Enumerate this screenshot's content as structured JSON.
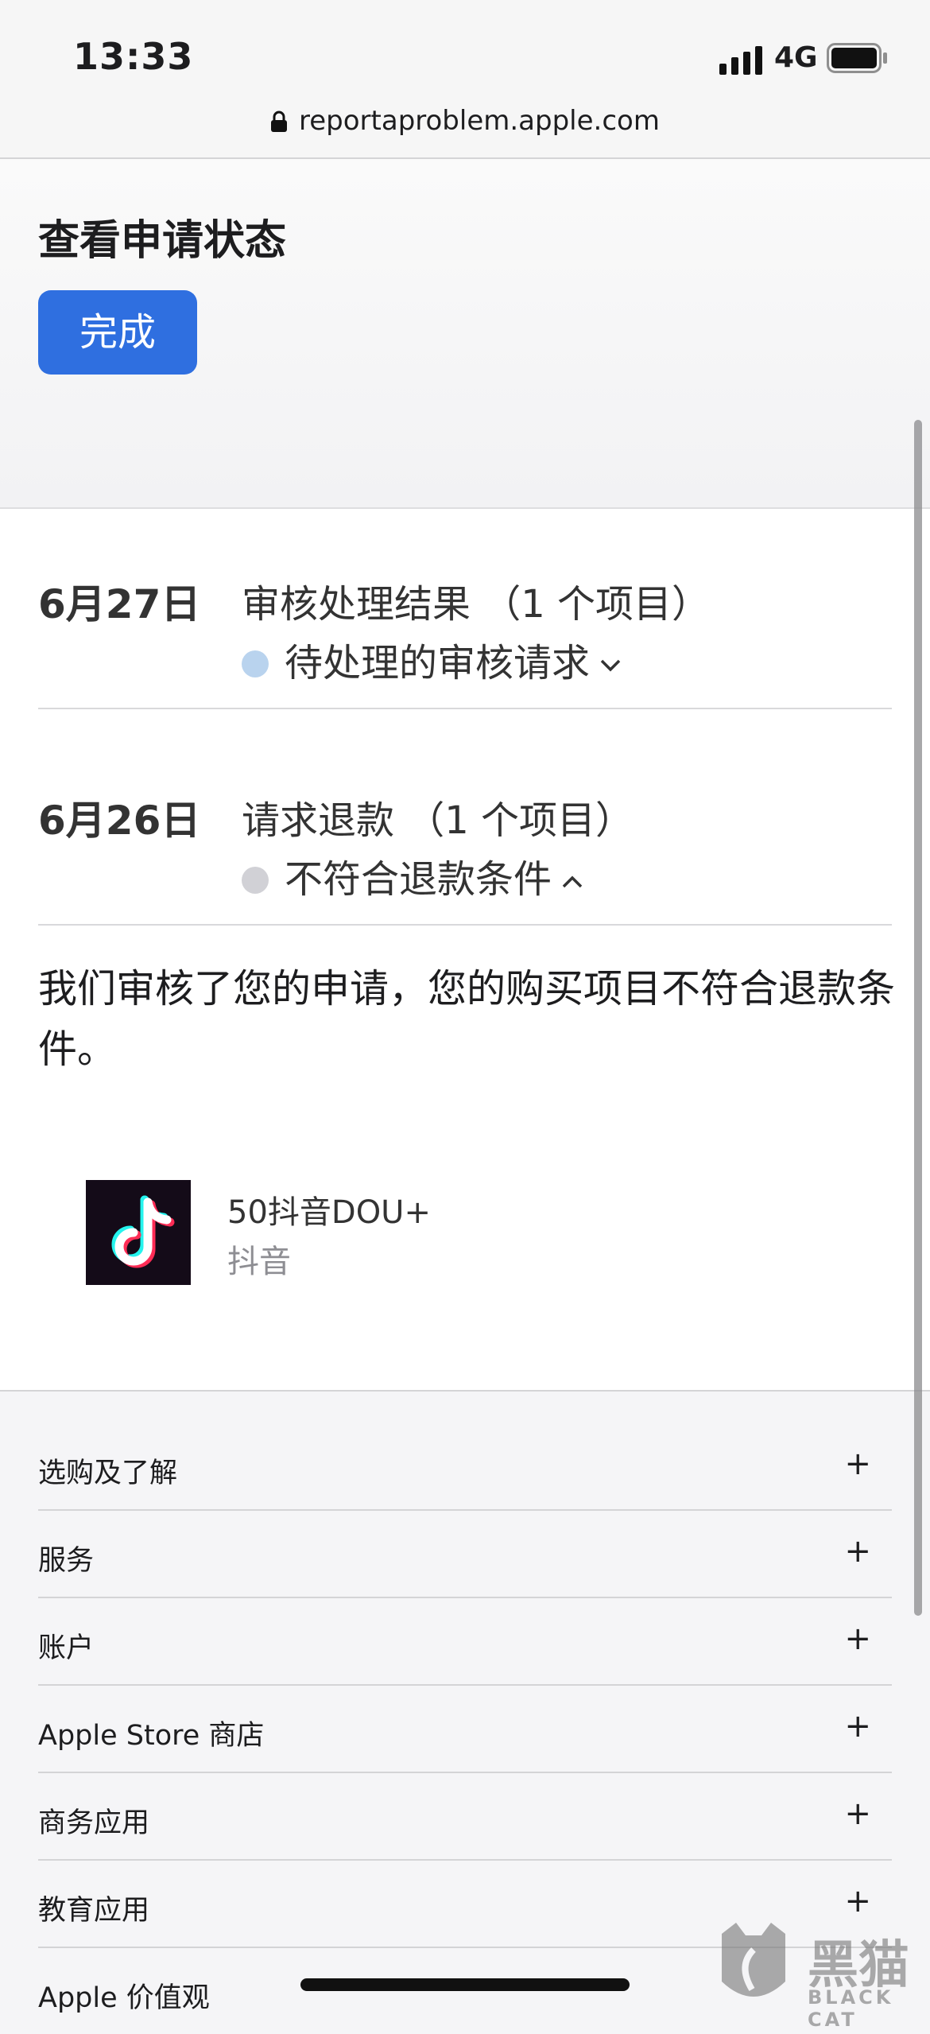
{
  "status_bar": {
    "time": "13:33",
    "network": "4G"
  },
  "browser": {
    "url": "reportaproblem.apple.com"
  },
  "header": {
    "title": "查看申请状态",
    "done_label": "完成"
  },
  "requests": [
    {
      "date": "6月27日",
      "title": "审核处理结果 （1 个项目）",
      "status": "待处理的审核请求",
      "status_color": "#b9d3ee",
      "expanded": false
    },
    {
      "date": "6月26日",
      "title": "请求退款 （1 个项目）",
      "status": "不符合退款条件",
      "status_color": "#d1d1d6",
      "expanded": true
    }
  ],
  "message": "我们审核了您的申请，您的购买项目不符合退款条件。",
  "item": {
    "name": "50抖音DOU+",
    "developer": "抖音",
    "icon": "tiktok-icon"
  },
  "footer": {
    "items": [
      {
        "label": "选购及了解"
      },
      {
        "label": "服务"
      },
      {
        "label": "账户"
      },
      {
        "label": "Apple Store 商店"
      },
      {
        "label": "商务应用"
      },
      {
        "label": "教育应用"
      },
      {
        "label": "Apple 价值观"
      }
    ],
    "expand_symbol": "+"
  },
  "watermark": {
    "text": "黑猫",
    "subtext": "BLACK CAT"
  }
}
